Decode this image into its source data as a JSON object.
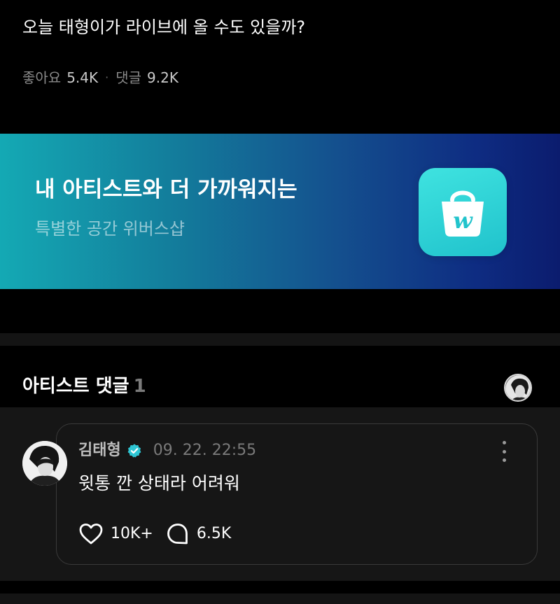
{
  "post": {
    "text": "오늘 태형이가 라이브에 올 수도 있을까?",
    "likes_label": "좋아요",
    "likes_count": "5.4K",
    "separator": "·",
    "comments_label": "댓글",
    "comments_count": "9.2K"
  },
  "banner": {
    "title": "내 아티스트와 더 가까워지는",
    "subtitle": "특별한 공간 위버스샵",
    "icon": "weverse-shop-bag-icon",
    "icon_letter": "w",
    "colors": {
      "start": "#14a9b4",
      "end": "#0b1c6e",
      "icon_bg": "#2fd3d6"
    }
  },
  "artist_comments": {
    "title": "아티스트 댓글",
    "count": "1"
  },
  "comment": {
    "author": "김태형",
    "verified_icon": "verified-badge-icon",
    "verified_color": "#2ec6d4",
    "timestamp": "09. 22. 22:55",
    "text": "윗통 깐 상태라 어려워",
    "likes": "10K+",
    "replies": "6.5K"
  }
}
